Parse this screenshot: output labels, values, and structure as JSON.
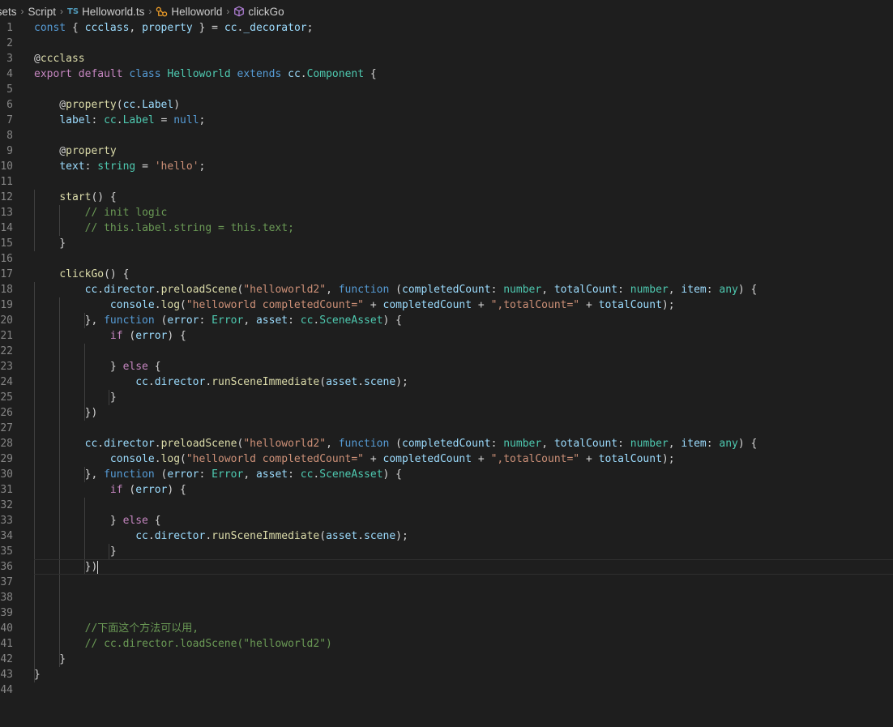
{
  "breadcrumb": {
    "items": [
      {
        "label": "ssets",
        "icon": ""
      },
      {
        "label": "Script",
        "icon": ""
      },
      {
        "label": "Helloworld.ts",
        "icon": "ts-file-icon",
        "badge": "TS"
      },
      {
        "label": "Helloworld",
        "icon": "class-icon"
      },
      {
        "label": "clickGo",
        "icon": "method-cube-icon"
      }
    ],
    "colors": {
      "class_icon": "#ee9d28",
      "method_icon": "#b180d7",
      "ts_badge": "#519aba"
    }
  },
  "editor": {
    "language": "typescript",
    "cursor_line": 36,
    "theme": {
      "background": "#1e1e1e",
      "foreground": "#d4d4d4"
    },
    "lines": [
      {
        "n": "1",
        "tokens": [
          [
            "k",
            "const"
          ],
          [
            "p",
            " { "
          ],
          [
            "v",
            "ccclass"
          ],
          [
            "p",
            ", "
          ],
          [
            "v",
            "property"
          ],
          [
            "p",
            " } = "
          ],
          [
            "v",
            "cc"
          ],
          [
            "p",
            "."
          ],
          [
            "v",
            "_decorator"
          ],
          [
            "p",
            ";"
          ]
        ]
      },
      {
        "n": "2",
        "tokens": []
      },
      {
        "n": "3",
        "tokens": [
          [
            "p",
            "@"
          ],
          [
            "f",
            "ccclass"
          ]
        ]
      },
      {
        "n": "4",
        "tokens": [
          [
            "c",
            "export"
          ],
          [
            "p",
            " "
          ],
          [
            "c",
            "default"
          ],
          [
            "p",
            " "
          ],
          [
            "k",
            "class"
          ],
          [
            "p",
            " "
          ],
          [
            "t",
            "Helloworld"
          ],
          [
            "p",
            " "
          ],
          [
            "k",
            "extends"
          ],
          [
            "p",
            " "
          ],
          [
            "v",
            "cc"
          ],
          [
            "p",
            "."
          ],
          [
            "t",
            "Component"
          ],
          [
            "p",
            " {"
          ]
        ]
      },
      {
        "n": "5",
        "tokens": []
      },
      {
        "n": "6",
        "tokens": [
          [
            "p",
            "    @"
          ],
          [
            "f",
            "property"
          ],
          [
            "p",
            "("
          ],
          [
            "v",
            "cc"
          ],
          [
            "p",
            "."
          ],
          [
            "v",
            "Label"
          ],
          [
            "p",
            ")"
          ]
        ]
      },
      {
        "n": "7",
        "tokens": [
          [
            "p",
            "    "
          ],
          [
            "v",
            "label"
          ],
          [
            "p",
            ": "
          ],
          [
            "t",
            "cc"
          ],
          [
            "p",
            "."
          ],
          [
            "t",
            "Label"
          ],
          [
            "p",
            " = "
          ],
          [
            "k",
            "null"
          ],
          [
            "p",
            ";"
          ]
        ]
      },
      {
        "n": "8",
        "tokens": []
      },
      {
        "n": "9",
        "tokens": [
          [
            "p",
            "    @"
          ],
          [
            "f",
            "property"
          ]
        ]
      },
      {
        "n": "10",
        "tokens": [
          [
            "p",
            "    "
          ],
          [
            "v",
            "text"
          ],
          [
            "p",
            ": "
          ],
          [
            "t",
            "string"
          ],
          [
            "p",
            " = "
          ],
          [
            "s",
            "'hello'"
          ],
          [
            "p",
            ";"
          ]
        ]
      },
      {
        "n": "11",
        "tokens": []
      },
      {
        "n": "12",
        "tokens": [
          [
            "p",
            "    "
          ],
          [
            "f",
            "start"
          ],
          [
            "p",
            "() {"
          ]
        ]
      },
      {
        "n": "13",
        "tokens": [
          [
            "p",
            "        "
          ],
          [
            "m",
            "// init logic"
          ]
        ]
      },
      {
        "n": "14",
        "tokens": [
          [
            "p",
            "        "
          ],
          [
            "m",
            "// this.label.string = this.text;"
          ]
        ]
      },
      {
        "n": "15",
        "tokens": [
          [
            "p",
            "    }"
          ]
        ]
      },
      {
        "n": "16",
        "tokens": []
      },
      {
        "n": "17",
        "tokens": [
          [
            "p",
            "    "
          ],
          [
            "f",
            "clickGo"
          ],
          [
            "p",
            "() {"
          ]
        ]
      },
      {
        "n": "18",
        "tokens": [
          [
            "p",
            "        "
          ],
          [
            "v",
            "cc"
          ],
          [
            "p",
            "."
          ],
          [
            "v",
            "director"
          ],
          [
            "p",
            "."
          ],
          [
            "f",
            "preloadScene"
          ],
          [
            "p",
            "("
          ],
          [
            "s",
            "\"helloworld2\""
          ],
          [
            "p",
            ", "
          ],
          [
            "k",
            "function"
          ],
          [
            "p",
            " ("
          ],
          [
            "v",
            "completedCount"
          ],
          [
            "p",
            ": "
          ],
          [
            "t",
            "number"
          ],
          [
            "p",
            ", "
          ],
          [
            "v",
            "totalCount"
          ],
          [
            "p",
            ": "
          ],
          [
            "t",
            "number"
          ],
          [
            "p",
            ", "
          ],
          [
            "v",
            "item"
          ],
          [
            "p",
            ": "
          ],
          [
            "t",
            "any"
          ],
          [
            "p",
            ") {"
          ]
        ]
      },
      {
        "n": "19",
        "tokens": [
          [
            "p",
            "            "
          ],
          [
            "v",
            "console"
          ],
          [
            "p",
            "."
          ],
          [
            "f",
            "log"
          ],
          [
            "p",
            "("
          ],
          [
            "s",
            "\"helloworld completedCount=\""
          ],
          [
            "p",
            " + "
          ],
          [
            "v",
            "completedCount"
          ],
          [
            "p",
            " + "
          ],
          [
            "s",
            "\",totalCount=\""
          ],
          [
            "p",
            " + "
          ],
          [
            "v",
            "totalCount"
          ],
          [
            "p",
            ");"
          ]
        ]
      },
      {
        "n": "20",
        "tokens": [
          [
            "p",
            "        }, "
          ],
          [
            "k",
            "function"
          ],
          [
            "p",
            " ("
          ],
          [
            "v",
            "error"
          ],
          [
            "p",
            ": "
          ],
          [
            "t",
            "Error"
          ],
          [
            "p",
            ", "
          ],
          [
            "v",
            "asset"
          ],
          [
            "p",
            ": "
          ],
          [
            "t",
            "cc"
          ],
          [
            "p",
            "."
          ],
          [
            "t",
            "SceneAsset"
          ],
          [
            "p",
            ") {"
          ]
        ]
      },
      {
        "n": "21",
        "tokens": [
          [
            "p",
            "            "
          ],
          [
            "c",
            "if"
          ],
          [
            "p",
            " ("
          ],
          [
            "v",
            "error"
          ],
          [
            "p",
            ") {"
          ]
        ]
      },
      {
        "n": "22",
        "tokens": []
      },
      {
        "n": "23",
        "tokens": [
          [
            "p",
            "            } "
          ],
          [
            "c",
            "else"
          ],
          [
            "p",
            " {"
          ]
        ]
      },
      {
        "n": "24",
        "tokens": [
          [
            "p",
            "                "
          ],
          [
            "v",
            "cc"
          ],
          [
            "p",
            "."
          ],
          [
            "v",
            "director"
          ],
          [
            "p",
            "."
          ],
          [
            "f",
            "runSceneImmediate"
          ],
          [
            "p",
            "("
          ],
          [
            "v",
            "asset"
          ],
          [
            "p",
            "."
          ],
          [
            "v",
            "scene"
          ],
          [
            "p",
            ");"
          ]
        ]
      },
      {
        "n": "25",
        "tokens": [
          [
            "p",
            "            }"
          ]
        ]
      },
      {
        "n": "26",
        "tokens": [
          [
            "p",
            "        })"
          ]
        ]
      },
      {
        "n": "27",
        "tokens": []
      },
      {
        "n": "28",
        "tokens": [
          [
            "p",
            "        "
          ],
          [
            "v",
            "cc"
          ],
          [
            "p",
            "."
          ],
          [
            "v",
            "director"
          ],
          [
            "p",
            "."
          ],
          [
            "f",
            "preloadScene"
          ],
          [
            "p",
            "("
          ],
          [
            "s",
            "\"helloworld2\""
          ],
          [
            "p",
            ", "
          ],
          [
            "k",
            "function"
          ],
          [
            "p",
            " ("
          ],
          [
            "v",
            "completedCount"
          ],
          [
            "p",
            ": "
          ],
          [
            "t",
            "number"
          ],
          [
            "p",
            ", "
          ],
          [
            "v",
            "totalCount"
          ],
          [
            "p",
            ": "
          ],
          [
            "t",
            "number"
          ],
          [
            "p",
            ", "
          ],
          [
            "v",
            "item"
          ],
          [
            "p",
            ": "
          ],
          [
            "t",
            "any"
          ],
          [
            "p",
            ") {"
          ]
        ]
      },
      {
        "n": "29",
        "tokens": [
          [
            "p",
            "            "
          ],
          [
            "v",
            "console"
          ],
          [
            "p",
            "."
          ],
          [
            "f",
            "log"
          ],
          [
            "p",
            "("
          ],
          [
            "s",
            "\"helloworld completedCount=\""
          ],
          [
            "p",
            " + "
          ],
          [
            "v",
            "completedCount"
          ],
          [
            "p",
            " + "
          ],
          [
            "s",
            "\",totalCount=\""
          ],
          [
            "p",
            " + "
          ],
          [
            "v",
            "totalCount"
          ],
          [
            "p",
            ");"
          ]
        ]
      },
      {
        "n": "30",
        "tokens": [
          [
            "p",
            "        }, "
          ],
          [
            "k",
            "function"
          ],
          [
            "p",
            " ("
          ],
          [
            "v",
            "error"
          ],
          [
            "p",
            ": "
          ],
          [
            "t",
            "Error"
          ],
          [
            "p",
            ", "
          ],
          [
            "v",
            "asset"
          ],
          [
            "p",
            ": "
          ],
          [
            "t",
            "cc"
          ],
          [
            "p",
            "."
          ],
          [
            "t",
            "SceneAsset"
          ],
          [
            "p",
            ") {"
          ]
        ]
      },
      {
        "n": "31",
        "tokens": [
          [
            "p",
            "            "
          ],
          [
            "c",
            "if"
          ],
          [
            "p",
            " ("
          ],
          [
            "v",
            "error"
          ],
          [
            "p",
            ") {"
          ]
        ]
      },
      {
        "n": "32",
        "tokens": []
      },
      {
        "n": "33",
        "tokens": [
          [
            "p",
            "            } "
          ],
          [
            "c",
            "else"
          ],
          [
            "p",
            " {"
          ]
        ]
      },
      {
        "n": "34",
        "tokens": [
          [
            "p",
            "                "
          ],
          [
            "v",
            "cc"
          ],
          [
            "p",
            "."
          ],
          [
            "v",
            "director"
          ],
          [
            "p",
            "."
          ],
          [
            "f",
            "runSceneImmediate"
          ],
          [
            "p",
            "("
          ],
          [
            "v",
            "asset"
          ],
          [
            "p",
            "."
          ],
          [
            "v",
            "scene"
          ],
          [
            "p",
            ");"
          ]
        ]
      },
      {
        "n": "35",
        "tokens": [
          [
            "p",
            "            }"
          ]
        ]
      },
      {
        "n": "36",
        "tokens": [
          [
            "p",
            "        })"
          ]
        ]
      },
      {
        "n": "37",
        "tokens": []
      },
      {
        "n": "38",
        "tokens": []
      },
      {
        "n": "39",
        "tokens": []
      },
      {
        "n": "40",
        "tokens": [
          [
            "p",
            "        "
          ],
          [
            "m",
            "//下面这个方法可以用,"
          ]
        ]
      },
      {
        "n": "41",
        "tokens": [
          [
            "p",
            "        "
          ],
          [
            "m",
            "// cc.director.loadScene(\"helloworld2\")"
          ]
        ]
      },
      {
        "n": "42",
        "tokens": [
          [
            "p",
            "    }"
          ]
        ]
      },
      {
        "n": "43",
        "tokens": [
          [
            "p",
            "}"
          ]
        ]
      },
      {
        "n": "44",
        "tokens": []
      }
    ]
  }
}
